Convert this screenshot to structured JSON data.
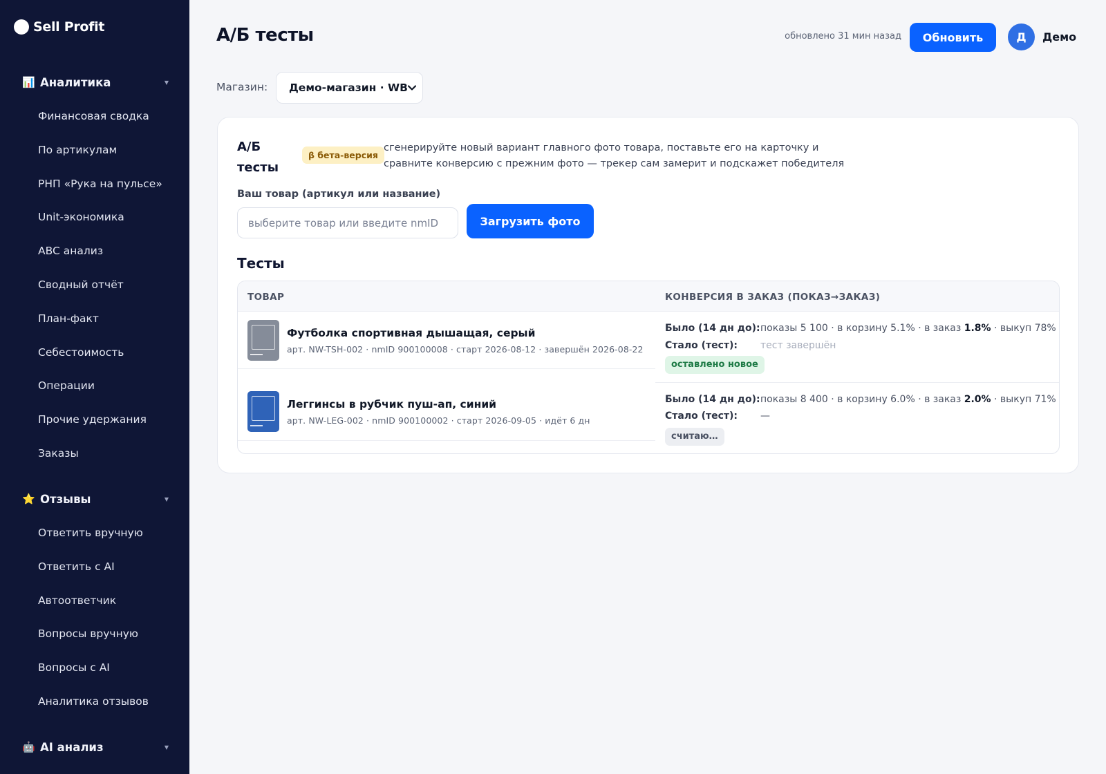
{
  "app": {
    "logo_text": "Sell Profit"
  },
  "sidebar": {
    "sections": [
      {
        "icon": "chart-icon",
        "icon_glyph": "📊",
        "label": "Аналитика",
        "items": [
          "Финансовая сводка",
          "По артикулам",
          "РНП «Рука на пульсе»",
          "Unit-экономика",
          "ABC анализ",
          "Сводный отчёт",
          "План-факт",
          "Себестоимость",
          "Операции",
          "Прочие удержания",
          "Заказы"
        ]
      },
      {
        "icon": "star-icon",
        "icon_glyph": "⭐",
        "label": "Отзывы",
        "items": [
          "Ответить вручную",
          "Ответить с AI",
          "Автоответчик",
          "Вопросы вручную",
          "Вопросы с AI",
          "Аналитика отзывов"
        ]
      },
      {
        "icon": "robot-icon",
        "icon_glyph": "🤖",
        "label": "AI анализ",
        "items": []
      }
    ]
  },
  "header": {
    "title": "А/Б тесты",
    "updated": "обновлено 31 мин назад",
    "refresh_label": "Обновить",
    "avatar_letter": "Д",
    "user_name": "Демо"
  },
  "store": {
    "label": "Магазин:",
    "value": "Демо-магазин · WB"
  },
  "card": {
    "title": "А/Б тесты",
    "beta": "β бета-версия",
    "description": "сгенерируйте новый вариант главного фото товара, поставьте его на карточку и сравните конверсию с прежним фото — трекер сам замерит и подскажет победителя",
    "field_label": "Ваш товар (артикул или название)",
    "field_placeholder": "выберите товар или введите nmID",
    "upload_label": "Загрузить фото",
    "tests_title": "Тесты"
  },
  "table": {
    "columns": [
      "ТОВАР",
      "КОНВЕРСИЯ В ЗАКАЗ (ПОКАЗ→ЗАКАЗ)"
    ],
    "rows": [
      {
        "thumb_color": "#858c99",
        "name": "Футболка спортивная дышащая, серый",
        "meta": "арт. NW-TSH-002 · nmID 900100008 · старт 2026-08-12 · завершён 2026-08-22",
        "before_label": "Было (14 дн до):",
        "before_prefix": "показы 5 100 · в корзину 5.1% · в заказ ",
        "before_order": "1.8%",
        "before_suffix": " · выкуп 78%",
        "after_label": "Стало (тест):",
        "after_value": "тест завершён",
        "status": "оставлено новое"
      },
      {
        "thumb_color": "#2f63b8",
        "name": "Леггинсы в рубчик пуш-ап, синий",
        "meta": "арт. NW-LEG-002 · nmID 900100002 · старт 2026-09-05 · идёт 6 дн",
        "before_label": "Было (14 дн до):",
        "before_prefix": "показы 8 400 · в корзину 6.0% · в заказ ",
        "before_order": "2.0%",
        "before_suffix": " · выкуп 71%",
        "after_label": "Стало (тест):",
        "after_value": "—",
        "status": "считаю…"
      }
    ]
  }
}
